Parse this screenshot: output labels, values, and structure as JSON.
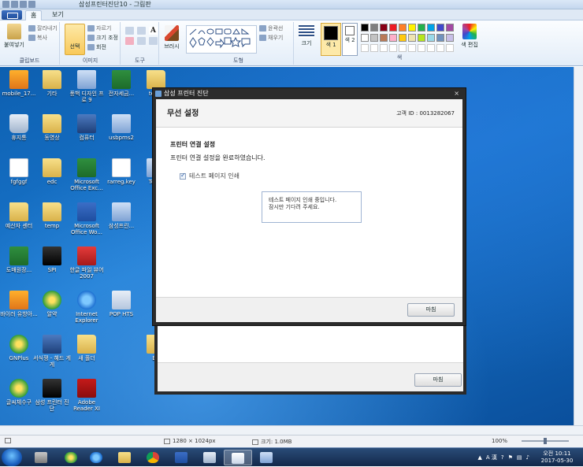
{
  "window": {
    "title": "삼성프린터진단10 - 그림판"
  },
  "ribbon": {
    "tabs": [
      {
        "label": "홈"
      },
      {
        "label": "보기"
      }
    ],
    "clipboard": {
      "paste": "붙여넣기",
      "cut": "잘라내기",
      "copy": "복사",
      "group": "클립보드"
    },
    "image": {
      "select": "선택",
      "crop": "자르기",
      "resize": "크기 조정",
      "rotate": "회전",
      "group": "이미지"
    },
    "tools": {
      "group": "도구"
    },
    "brushes": {
      "label": "브러시"
    },
    "shapes": {
      "outline": "윤곽선",
      "fill": "채우기",
      "group": "도형"
    },
    "size": {
      "label": "크기"
    },
    "colors": {
      "color1": "색 1",
      "color2": "색 2",
      "edit": "색 편집",
      "group": "색",
      "palette_row1": [
        "#000000",
        "#7f7f7f",
        "#880015",
        "#ed1c24",
        "#ff7f27",
        "#fff200",
        "#22b14c",
        "#00a2e8",
        "#3f48cc",
        "#a349a4"
      ],
      "palette_row2": [
        "#ffffff",
        "#c3c3c3",
        "#b97a57",
        "#ffaec9",
        "#ffc90e",
        "#efe4b0",
        "#b5e61d",
        "#99d9ea",
        "#7092be",
        "#c8bfe7"
      ]
    }
  },
  "desktop": {
    "icons": [
      {
        "label": "mobile_17...",
        "kind": "i-orange"
      },
      {
        "label": "기타",
        "kind": "i-folder"
      },
      {
        "label": "풍백 디자인 프로 9",
        "kind": "i-app"
      },
      {
        "label": "전자세금...",
        "kind": "i-excel"
      },
      {
        "label": "team",
        "kind": "i-folder"
      },
      {
        "label": "휴지통",
        "kind": "i-bin"
      },
      {
        "label": "동영상",
        "kind": "i-folder"
      },
      {
        "label": "컴퓨터",
        "kind": "i-pc"
      },
      {
        "label": "usbpms2",
        "kind": "i-app"
      },
      {
        "label": "fgfggf",
        "kind": "i-doc"
      },
      {
        "label": "edc",
        "kind": "i-folder"
      },
      {
        "label": "Microsoft Office Exc...",
        "kind": "i-excel"
      },
      {
        "label": "rarreg.key",
        "kind": "i-doc"
      },
      {
        "label": "Team",
        "kind": "i-app"
      },
      {
        "label": "예산자 센터",
        "kind": "i-folder"
      },
      {
        "label": "temp",
        "kind": "i-folder"
      },
      {
        "label": "Microsoft Office Wo...",
        "kind": "i-word"
      },
      {
        "label": "삼성프린...",
        "kind": "i-app"
      },
      {
        "label": "도매원장...",
        "kind": "i-excel"
      },
      {
        "label": "SPI",
        "kind": "i-black"
      },
      {
        "label": "한글 파일 뷰어 2007",
        "kind": "i-red"
      },
      {
        "label": "바이러 유방아...",
        "kind": "i-orange"
      },
      {
        "label": "알약",
        "kind": "i-green"
      },
      {
        "label": "Internet Explorer",
        "kind": "i-ie"
      },
      {
        "label": "POP HTS",
        "kind": "i-pop"
      },
      {
        "label": "GNPlus",
        "kind": "i-green"
      },
      {
        "label": "서식쟁 - 혜드 게게",
        "kind": "i-pc"
      },
      {
        "label": "새 폴더",
        "kind": "i-folder"
      },
      {
        "label": "BB",
        "kind": "i-folder"
      },
      {
        "label": "글씨체수구",
        "kind": "i-green"
      },
      {
        "label": "삼성 프린터 진단",
        "kind": "i-black"
      },
      {
        "label": "Adobe Reader XI",
        "kind": "i-pdf"
      }
    ]
  },
  "dialog": {
    "caption": "삼성 프린터 진단",
    "close": "×",
    "heading": "무선 설정",
    "customer_id": "고객 ID : 0013282067",
    "section": "프린터 연결 설정",
    "message": "프린터 연결 설정을 완료하였습니다.",
    "checkbox_label": "테스트 페이지 인쇄",
    "status_line1": "테스트 페이지 인쇄 중입니다.",
    "status_line2": "잠시만 기다려 주세요.",
    "finish": "마침"
  },
  "dialog_back": {
    "finish": "마침"
  },
  "statusbar": {
    "dimensions": "1280 × 1024px",
    "size": "크기: 1.0MB",
    "zoom": "100%"
  },
  "taskbar": {
    "tray_text": "A 漢",
    "time": "오전 10:11",
    "date": "2017-05-30"
  }
}
